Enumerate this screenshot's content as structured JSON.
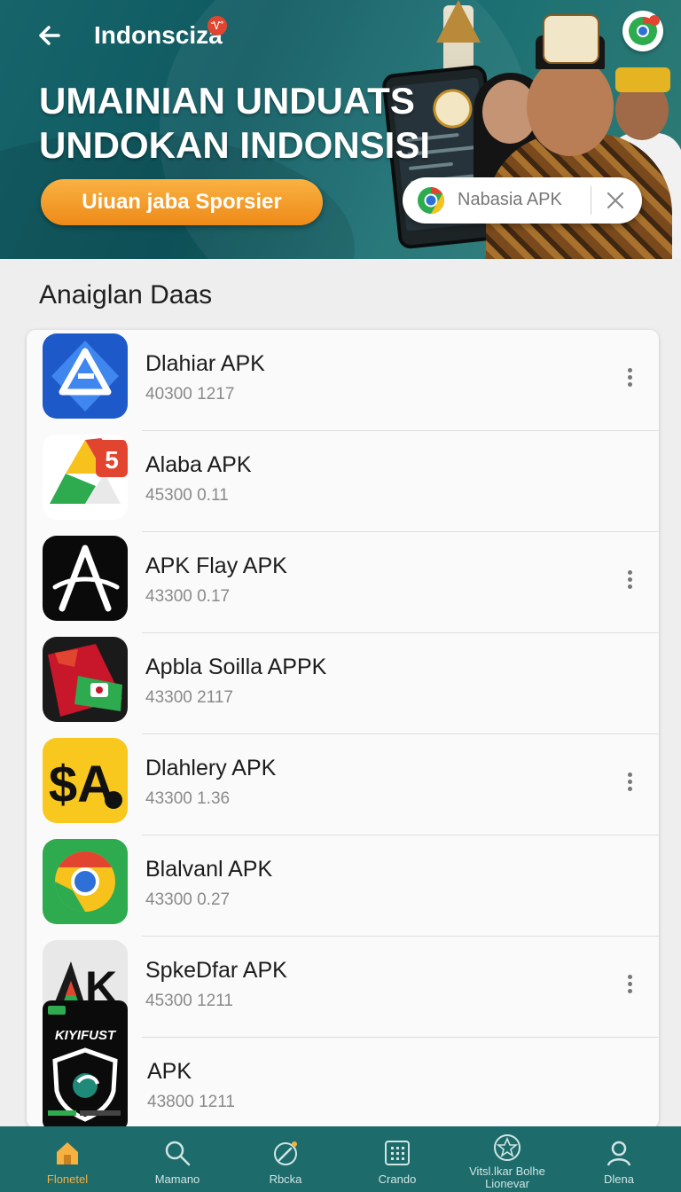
{
  "header": {
    "title": "Indonsciza",
    "title_badge": "Ꮙ",
    "hero_line1": "UMAINIAN UNDUATS",
    "hero_line2": "UNDOKAN INDONSISI",
    "cta_label": "Uiuan jaba Sporsier"
  },
  "search": {
    "value": "Nabasia APK"
  },
  "section": {
    "title": "Anaiglan Daas"
  },
  "apps": [
    {
      "name": "Dlahiar APK",
      "meta": "40300 1217",
      "icon": "blue-triangle-icon",
      "menu": true
    },
    {
      "name": "Alaba APK",
      "meta": "45300 0.11",
      "icon": "drive-triangle-icon",
      "menu": false,
      "badge": "5"
    },
    {
      "name": "APK Flay APK",
      "meta": "43300 0.17",
      "icon": "letter-a-icon",
      "menu": true
    },
    {
      "name": "Apbla Soilla APPK",
      "meta": "43300 2117",
      "icon": "red-green-fold-icon",
      "menu": false
    },
    {
      "name": "Dlahlery APK",
      "meta": "43300 1.36",
      "icon": "yellow-a-icon",
      "menu": true,
      "icon_text": "$A"
    },
    {
      "name": "Blalvanl APK",
      "meta": "43300 0.27",
      "icon": "chrome-icon",
      "menu": false
    },
    {
      "name": "SpkeDfar APK",
      "meta": "45300 1211",
      "icon": "ak-icon",
      "menu": true,
      "icon_text": "AK"
    },
    {
      "name": "APK",
      "meta": "43800 1211",
      "icon": "shield-icon",
      "menu": false,
      "icon_text": "KIYIFUST"
    }
  ],
  "nav": [
    {
      "label": "Flonetel",
      "icon": "home-icon",
      "active": true
    },
    {
      "label": "Mamano",
      "icon": "search-icon",
      "active": false
    },
    {
      "label": "Rbcka",
      "icon": "edit-icon",
      "active": false
    },
    {
      "label": "Crando",
      "icon": "grid-icon",
      "active": false
    },
    {
      "label": "Vitsl.lkar Bolhe Lionevar",
      "icon": "star-icon",
      "active": false
    },
    {
      "label": "Dlena",
      "icon": "profile-icon",
      "active": false
    }
  ],
  "colors": {
    "hero_teal": "#17646b",
    "cta_orange": "#ee8a18",
    "nav_bg": "#1e6b6c",
    "nav_active": "#f6b141"
  }
}
